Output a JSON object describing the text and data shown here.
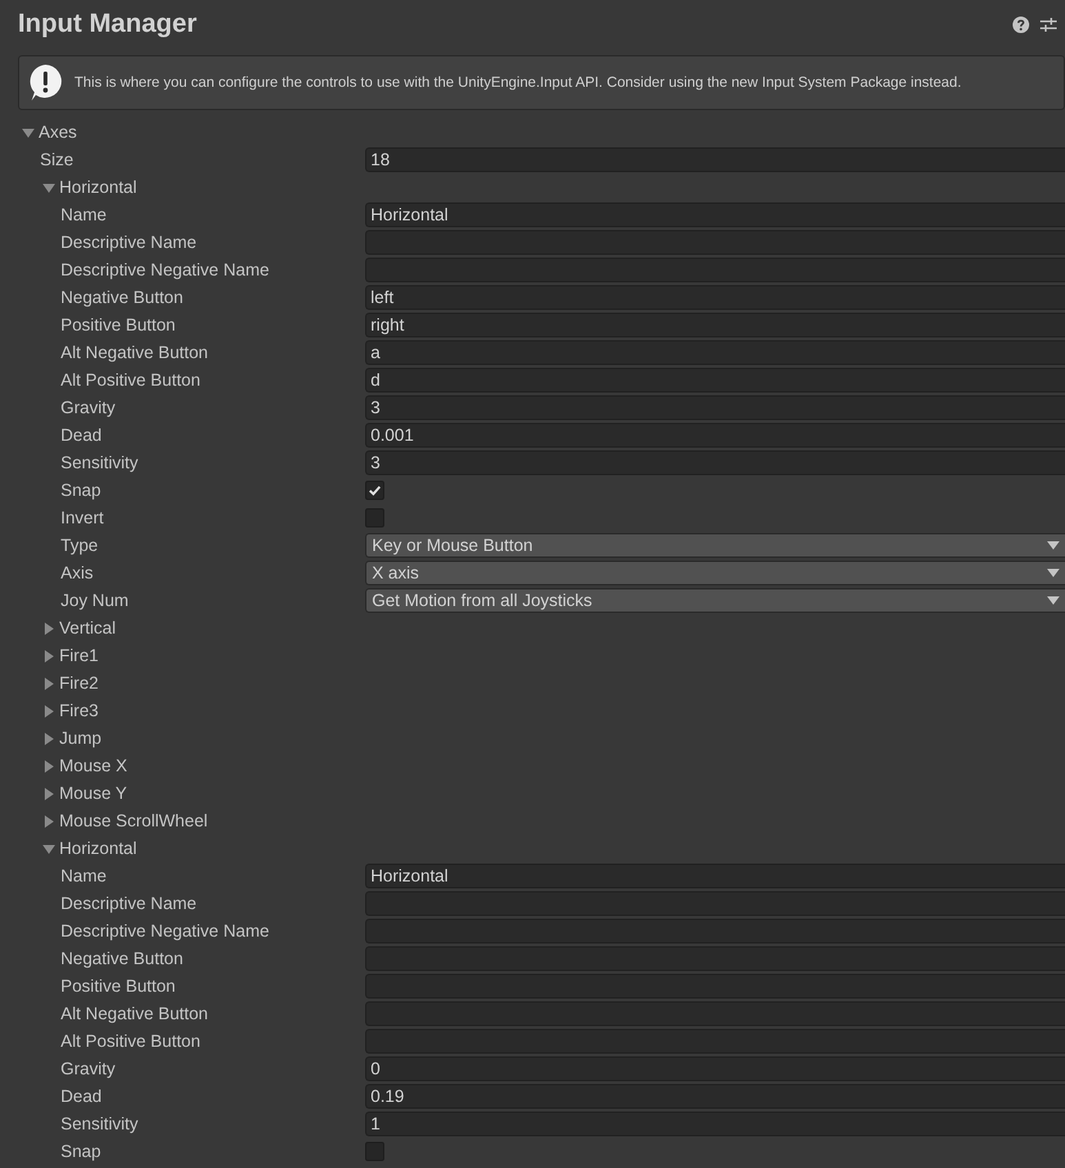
{
  "window": {
    "title": "Input Manager"
  },
  "help_box": {
    "message": "This is where you can configure the controls to use with the UnityEngine.Input API. Consider using the new Input System Package instead."
  },
  "axes": {
    "label": "Axes",
    "expanded": true,
    "size": {
      "label": "Size",
      "value": "18"
    },
    "children": [
      {
        "label": "Horizontal",
        "expanded": true,
        "fields": [
          {
            "label": "Name",
            "kind": "text",
            "value": "Horizontal"
          },
          {
            "label": "Descriptive Name",
            "kind": "text"
          },
          {
            "label": "Descriptive Negative Name",
            "kind": "text"
          },
          {
            "label": "Negative Button",
            "kind": "text",
            "value": "left"
          },
          {
            "label": "Positive Button",
            "kind": "text",
            "value": "right"
          },
          {
            "label": "Alt Negative Button",
            "kind": "text",
            "value": "a"
          },
          {
            "label": "Alt Positive Button",
            "kind": "text",
            "value": "d"
          },
          {
            "label": "Gravity",
            "kind": "text",
            "value": "3"
          },
          {
            "label": "Dead",
            "kind": "text",
            "value": "0.001"
          },
          {
            "label": "Sensitivity",
            "kind": "text",
            "value": "3"
          },
          {
            "label": "Snap",
            "kind": "checkbox",
            "checked": true
          },
          {
            "label": "Invert",
            "kind": "checkbox",
            "checked": false
          },
          {
            "label": "Type",
            "kind": "dropdown",
            "value": "Key or Mouse Button"
          },
          {
            "label": "Axis",
            "kind": "dropdown",
            "value": "X axis"
          },
          {
            "label": "Joy Num",
            "kind": "dropdown",
            "value": "Get Motion from all Joysticks"
          }
        ]
      },
      {
        "label": "Vertical",
        "expanded": false
      },
      {
        "label": "Fire1",
        "expanded": false
      },
      {
        "label": "Fire2",
        "expanded": false
      },
      {
        "label": "Fire3",
        "expanded": false
      },
      {
        "label": "Jump",
        "expanded": false
      },
      {
        "label": "Mouse X",
        "expanded": false
      },
      {
        "label": "Mouse Y",
        "expanded": false
      },
      {
        "label": "Mouse ScrollWheel",
        "expanded": false
      },
      {
        "label": "Horizontal",
        "expanded": true,
        "fields": [
          {
            "label": "Name",
            "kind": "text",
            "value": "Horizontal"
          },
          {
            "label": "Descriptive Name",
            "kind": "text"
          },
          {
            "label": "Descriptive Negative Name",
            "kind": "text"
          },
          {
            "label": "Negative Button",
            "kind": "text"
          },
          {
            "label": "Positive Button",
            "kind": "text"
          },
          {
            "label": "Alt Negative Button",
            "kind": "text"
          },
          {
            "label": "Alt Positive Button",
            "kind": "text"
          },
          {
            "label": "Gravity",
            "kind": "text",
            "value": "0"
          },
          {
            "label": "Dead",
            "kind": "text",
            "value": "0.19"
          },
          {
            "label": "Sensitivity",
            "kind": "text",
            "value": "1"
          },
          {
            "label": "Snap",
            "kind": "checkbox",
            "checked": false
          }
        ]
      }
    ]
  }
}
